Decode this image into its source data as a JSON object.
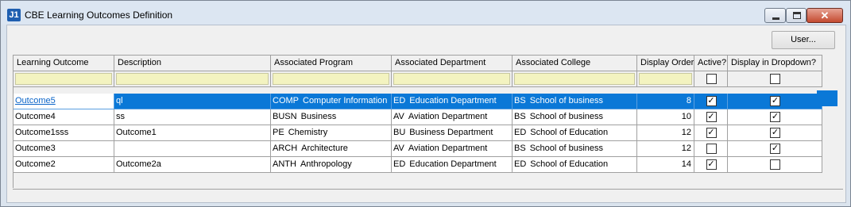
{
  "window": {
    "title": "CBE Learning Outcomes Definition",
    "app_icon": "J1"
  },
  "toolbar": {
    "user_label": "User..."
  },
  "columns": [
    "Learning Outcome",
    "Description",
    "Associated Program",
    "Associated Department",
    "Associated College",
    "Display Order",
    "Active?",
    "Display in Dropdown?"
  ],
  "rows": [
    {
      "outcome": "Outcome5",
      "description": "ql",
      "program_code": "COMP",
      "program": "Computer Information",
      "dept_code": "ED",
      "dept": "Education Department",
      "college_code": "BS",
      "college": "School of business",
      "order": "8",
      "active": true,
      "dropdown": true,
      "selected": true
    },
    {
      "outcome": "Outcome4",
      "description": "ss",
      "program_code": "BUSN",
      "program": "Business",
      "dept_code": "AV",
      "dept": "Aviation Department",
      "college_code": "BS",
      "college": "School of business",
      "order": "10",
      "active": true,
      "dropdown": true,
      "selected": false
    },
    {
      "outcome": "Outcome1sss",
      "description": "Outcome1",
      "program_code": "PE",
      "program": "Chemistry",
      "dept_code": "BU",
      "dept": "Business Department",
      "college_code": "ED",
      "college": "School of Education",
      "order": "12",
      "active": true,
      "dropdown": true,
      "selected": false
    },
    {
      "outcome": "Outcome3",
      "description": "",
      "program_code": "ARCH",
      "program": "Architecture",
      "dept_code": "AV",
      "dept": "Aviation Department",
      "college_code": "BS",
      "college": "School of business",
      "order": "12",
      "active": false,
      "dropdown": true,
      "selected": false
    },
    {
      "outcome": "Outcome2",
      "description": "Outcome2a",
      "program_code": "ANTH",
      "program": "Anthropology",
      "dept_code": "ED",
      "dept": "Education Department",
      "college_code": "ED",
      "college": "School of Education",
      "order": "14",
      "active": true,
      "dropdown": false,
      "selected": false
    }
  ],
  "colors": {
    "selection": "#0a78d7",
    "filter_fill": "#f3f3c0",
    "title_bg": "#dce6f2"
  }
}
